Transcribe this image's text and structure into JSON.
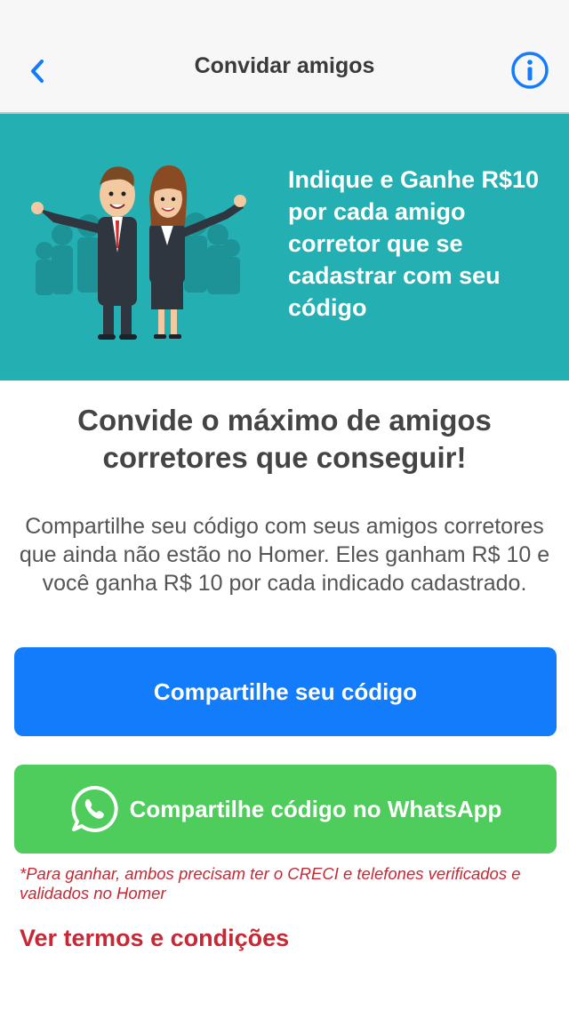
{
  "nav": {
    "title": "Convidar amigos",
    "back_icon": "chevron-left-icon",
    "info_icon": "info-icon",
    "accent_color": "#137cfb"
  },
  "hero": {
    "text": "Indique e Ganhe R$10 por cada amigo corretor que se cadastrar com seu código",
    "background_color": "#24b0b3"
  },
  "main": {
    "headline_line1": "Convide o máximo de amigos",
    "headline_line2": "corretores que conseguir!",
    "description": "Compartilhe seu código com seus amigos corretores que ainda não estão no Homer. Eles ganham R$ 10 e você ganha R$ 10 por cada indicado cadastrado."
  },
  "buttons": {
    "share_label": "Compartilhe seu código",
    "share_color": "#137cfb",
    "whatsapp_label": "Compartilhe código no WhatsApp",
    "whatsapp_color": "#4ecc5c",
    "whatsapp_icon": "whatsapp-icon"
  },
  "footer": {
    "note": "*Para ganhar, ambos precisam ter o CRECI e telefones verificados e validados no Homer",
    "terms_link": "Ver termos e condições",
    "link_color": "#c62835"
  }
}
